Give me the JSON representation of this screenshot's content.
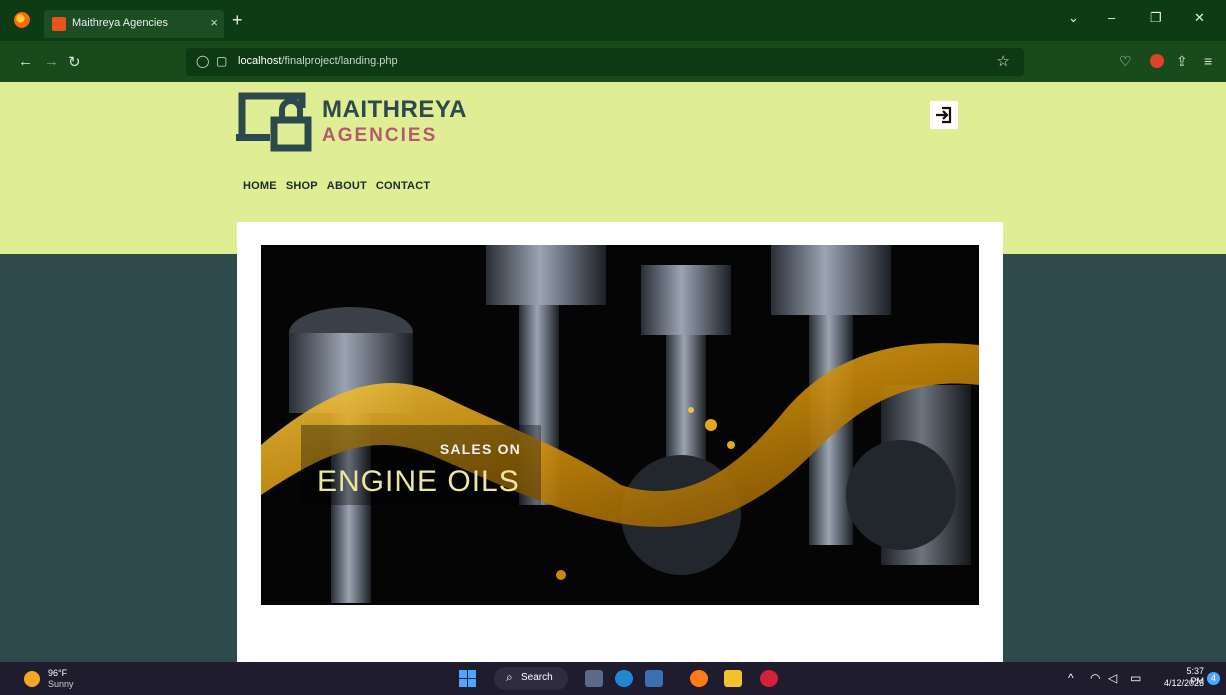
{
  "browser": {
    "tab_title": "Maithreya Agencies",
    "tab_close": "×",
    "new_tab": "+",
    "url_host": "localhost",
    "url_path": "/finalproject/landing.php"
  },
  "site": {
    "brand_main": "MAITHREYA",
    "brand_sub": "AGENCIES",
    "nav": [
      "HOME",
      "SHOP",
      "ABOUT",
      "CONTACT"
    ],
    "hero": {
      "small": "SALES ON",
      "big": "ENGINE OILS"
    },
    "colors": {
      "header": "#dfee94",
      "body": "#2e4a4c",
      "brand_main": "#2c4a4b",
      "brand_sub": "#b55a6e"
    }
  },
  "taskbar": {
    "temperature": "96°F",
    "condition": "Sunny",
    "search_label": "Search",
    "time": "5:37 PM",
    "date": "4/12/2023",
    "notifications": "4"
  }
}
